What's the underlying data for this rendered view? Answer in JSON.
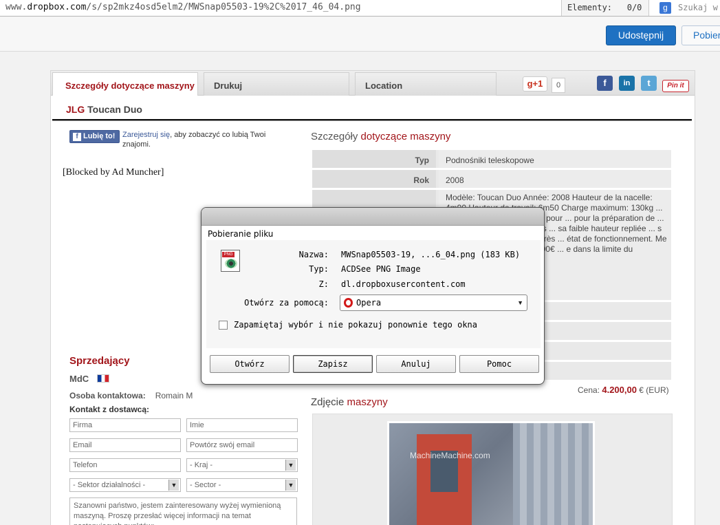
{
  "browser": {
    "url_prefix": "www.",
    "url_domain": "dropbox.com",
    "url_path": "/s/sp2mkz4osd5elm2/MWSnap05503-19%2C%2017_46_04.png",
    "elements_label": "Elementy:",
    "elements_count": "0/0",
    "search_placeholder": "Szukaj w"
  },
  "dropbox": {
    "share_label": "Udostępnij",
    "download_label": "Pobier"
  },
  "page": {
    "tabs": [
      "Szczegóły dotyczące maszyny",
      "Drukuj",
      "Location"
    ],
    "gplus": "g+1",
    "gplus_count": "0",
    "social": {
      "facebook": "f",
      "linkedin": "in",
      "twitter": "t",
      "pinterest": "Pin it"
    },
    "machine_brand": "JLG",
    "machine_model": " Toucan Duo",
    "like_button": "Lubię to!",
    "like_link": "Zarejestruj się",
    "like_text": ", aby zobaczyć co lubią Twoi znajomi.",
    "blocked_text": "[Blocked by Ad Muncher]",
    "details_heading_a": "Szczegóły ",
    "details_heading_b": "dotyczące maszyny",
    "details": {
      "type_label": "Typ",
      "type_value": "Podnośniki teleskopowe",
      "year_label": "Rok",
      "year_value": "2008",
      "description": "Modèle: Toucan Duo Année: 2008 Hauteur de la nacelle: 4m90 Hauteur de travail: 6m50 Charge maximum: 130kg ... ble accès latéral et tablette pour ... pour la préparation de ... de contrôle des stocks. Ses ... sa faible hauteur repliée ... s espaces confinés Nacelle très ... état de fonctionnement. Me ... seignements. Vendu 4200€ ... e dans la limite du raisonnable"
    },
    "seller_heading": "Sprzedający",
    "seller_name": "MdC",
    "contact_label": "Osoba kontaktowa:",
    "contact_name": "Romain M",
    "kontakt_heading": "Kontakt z dostawcą:",
    "form": {
      "firm": "Firma",
      "name": "Imie",
      "email": "Email",
      "email_repeat": "Powtórz swój email",
      "phone": "Telefon",
      "country": "- Kraj -",
      "sector_activity": "- Sektor działalności -",
      "sector": "- Sector -",
      "message": "Szanowni państwo, jestem zainteresowany wyżej wymienioną maszyną. Proszę przesłać więcej informacji na temat następujących punktów:"
    },
    "price_label": "Cena: ",
    "price_value": "4.200,00",
    "price_unit": " € (EUR)",
    "photo_heading_a": "Zdjęcie ",
    "photo_heading_b": "maszyny",
    "photo_watermark": "MachineMachine.com"
  },
  "dialog": {
    "title": "Pobieranie pliku",
    "name_label": "Nazwa:",
    "name_value": "MWSnap05503-19, ...6_04.png (183 KB)",
    "type_label": "Typ:",
    "type_value": "ACDSee PNG Image",
    "from_label": "Z:",
    "from_value": "dl.dropboxusercontent.com",
    "open_with_label": "Otwórz za pomocą:",
    "open_with_value": "Opera",
    "remember_label": "Zapamiętaj wybór i nie pokazuj ponownie tego okna",
    "buttons": [
      "Otwórz",
      "Zapisz",
      "Anuluj",
      "Pomoc"
    ]
  }
}
